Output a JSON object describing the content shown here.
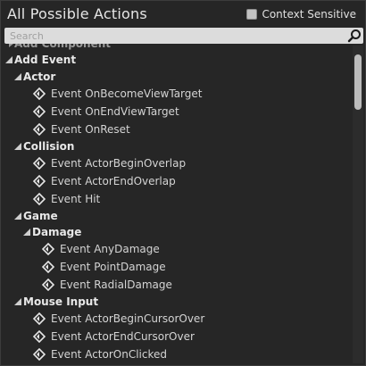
{
  "header": {
    "title": "All Possible Actions",
    "context_sensitive_label": "Context Sensitive",
    "context_sensitive_checked": false
  },
  "search": {
    "placeholder": "Search",
    "value": ""
  },
  "tree": {
    "partial_top_label": "Add Component",
    "add_event": {
      "label": "Add Event",
      "actor": {
        "label": "Actor",
        "items": [
          "Event OnBecomeViewTarget",
          "Event OnEndViewTarget",
          "Event OnReset"
        ]
      },
      "collision": {
        "label": "Collision",
        "items": [
          "Event ActorBeginOverlap",
          "Event ActorEndOverlap",
          "Event Hit"
        ]
      },
      "game": {
        "label": "Game",
        "damage": {
          "label": "Damage",
          "items": [
            "Event AnyDamage",
            "Event PointDamage",
            "Event RadialDamage"
          ]
        }
      },
      "mouse_input": {
        "label": "Mouse Input",
        "items": [
          "Event ActorBeginCursorOver",
          "Event ActorEndCursorOver",
          "Event ActorOnClicked"
        ]
      }
    }
  },
  "icons": {
    "search": "magnifier-icon",
    "expand": "triangle-expanded-icon",
    "event": "event-node-icon"
  },
  "colors": {
    "background": "#262626",
    "text": "#d4d4d4",
    "search_bg": "#dcdcdc",
    "scroll_thumb": "#bcbcbc"
  }
}
